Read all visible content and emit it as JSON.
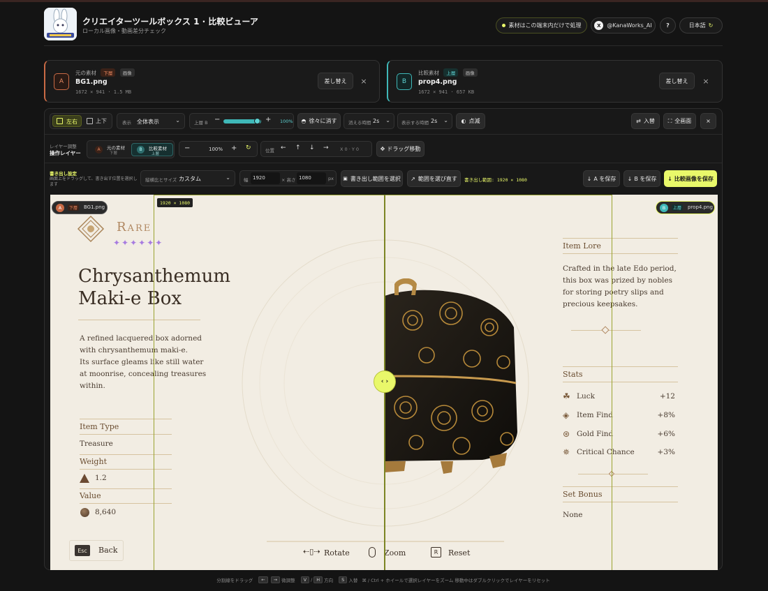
{
  "header": {
    "title": "クリエイターツールボックス 1 · 比較ビューア",
    "subtitle": "ローカル画像・動画差分チェック",
    "privacy_label": "素材はこの端末内だけで処理",
    "account_label": "@KanaWorks_AI",
    "help_label": "?",
    "language_label": "日本語"
  },
  "source_a": {
    "badge": "A",
    "role": "元の素材",
    "layer_tag": "下層",
    "type_tag": "画像",
    "filename": "BG1.png",
    "meta": "1672 × 941 · 1.5 MB",
    "replace_label": "差し替え",
    "remove_label": "×"
  },
  "source_b": {
    "badge": "B",
    "role": "比較素材",
    "layer_tag": "上層",
    "type_tag": "画像",
    "filename": "prop4.png",
    "meta": "1672 × 941 · 657 KB",
    "replace_label": "差し替え",
    "remove_label": "×"
  },
  "toolbar1": {
    "mode_lr": "左右",
    "mode_tb": "上下",
    "display_label": "表示",
    "display_value": "全体表示",
    "layer_label": "上層 B",
    "opacity_value": "100%",
    "opacity_fraction": 1.0,
    "fade_label": "徐々に消す",
    "vanish_time_label": "消える時間",
    "vanish_time_value": "2s",
    "show_time_label": "表示する時間",
    "show_time_value": "2s",
    "blink_label": "点滅",
    "swap_label": "入替",
    "fullscreen_label": "全画面",
    "close_label": "×"
  },
  "toolbar2": {
    "adjust_label": "レイヤー調整",
    "target_label": "操作レイヤー",
    "layer_a_name": "元の素材",
    "layer_a_tag": "下層",
    "layer_b_name": "比較素材",
    "layer_b_tag": "上層",
    "zoom_value": "100%",
    "position_label": "位置",
    "xy_readout": "X 0 · Y 0",
    "drag_label": "ドラッグ移動"
  },
  "toolbar3": {
    "export_title": "書き出し設定",
    "export_desc": "画面上をドラッグして、書き出す位置を選択します",
    "aspect_label": "縦横比とサイズ",
    "aspect_value": "カスタム",
    "width_label": "幅",
    "width_value": "1920",
    "height_label": "× 高さ",
    "height_value": "1080",
    "unit": "px",
    "select_range_label": "書き出し範囲を選択",
    "reselect_label": "範囲を選び直す",
    "range_readout": "書き出し範囲: 1920 × 1080",
    "save_a_label": "A を保存",
    "save_b_label": "B を保存",
    "save_compare_label": "比較画像を保存"
  },
  "canvas": {
    "size_badge": "1920 × 1080",
    "left_badge_letter": "A",
    "left_badge_tag": "下層",
    "left_badge_file": "BG1.png",
    "right_badge_letter": "B",
    "right_badge_tag": "上層",
    "right_badge_file": "prop4.png",
    "rarity": "Rare",
    "item_title_1": "Chrysanthemum",
    "item_title_2": "Maki-e Box",
    "description": [
      "A refined lacquered box adorned",
      "with chrysanthemum maki-e.",
      "Its surface gleams like still water",
      "at moonrise, concealing treasures",
      "within."
    ],
    "item_type_label": "Item Type",
    "item_type_value": "Treasure",
    "weight_label": "Weight",
    "weight_value": "1.2",
    "value_label": "Value",
    "value_value": "8,640",
    "lore_label": "Item Lore",
    "lore_lines": [
      "Crafted in the late Edo period,",
      "this box was prized by nobles",
      "for storing poetry slips and",
      "precious keepsakes."
    ],
    "stats_label": "Stats",
    "stats": [
      {
        "name": "Luck",
        "value": "+12"
      },
      {
        "name": "Item Find",
        "value": "+8%"
      },
      {
        "name": "Gold Find",
        "value": "+6%"
      },
      {
        "name": "Critical Chance",
        "value": "+3%"
      }
    ],
    "set_bonus_label": "Set Bonus",
    "set_bonus_value": "None",
    "esc_key": "Esc",
    "back_label": "Back",
    "rotate_label": "Rotate",
    "zoom_label": "Zoom",
    "reset_key": "R",
    "reset_label": "Reset"
  },
  "footer": {
    "drag_hint": "分割線をドラッグ",
    "k1": "←",
    "k2": "→",
    "adjust_hint": "微調整",
    "k3": "V",
    "k4": "H",
    "dir_hint": "方向",
    "k5": "S",
    "swap_hint": "入替",
    "rest": "⌘ / Ctrl + ホイールで選択レイヤーをズーム   移動中はダブルクリックでレイヤーをリセット"
  },
  "colors": {
    "accent_yellow": "#e9f86a",
    "layer_a": "#c96a45",
    "layer_b": "#3fb8b8",
    "parchment": "#f2ede3",
    "gold_text": "#8a6a42"
  }
}
